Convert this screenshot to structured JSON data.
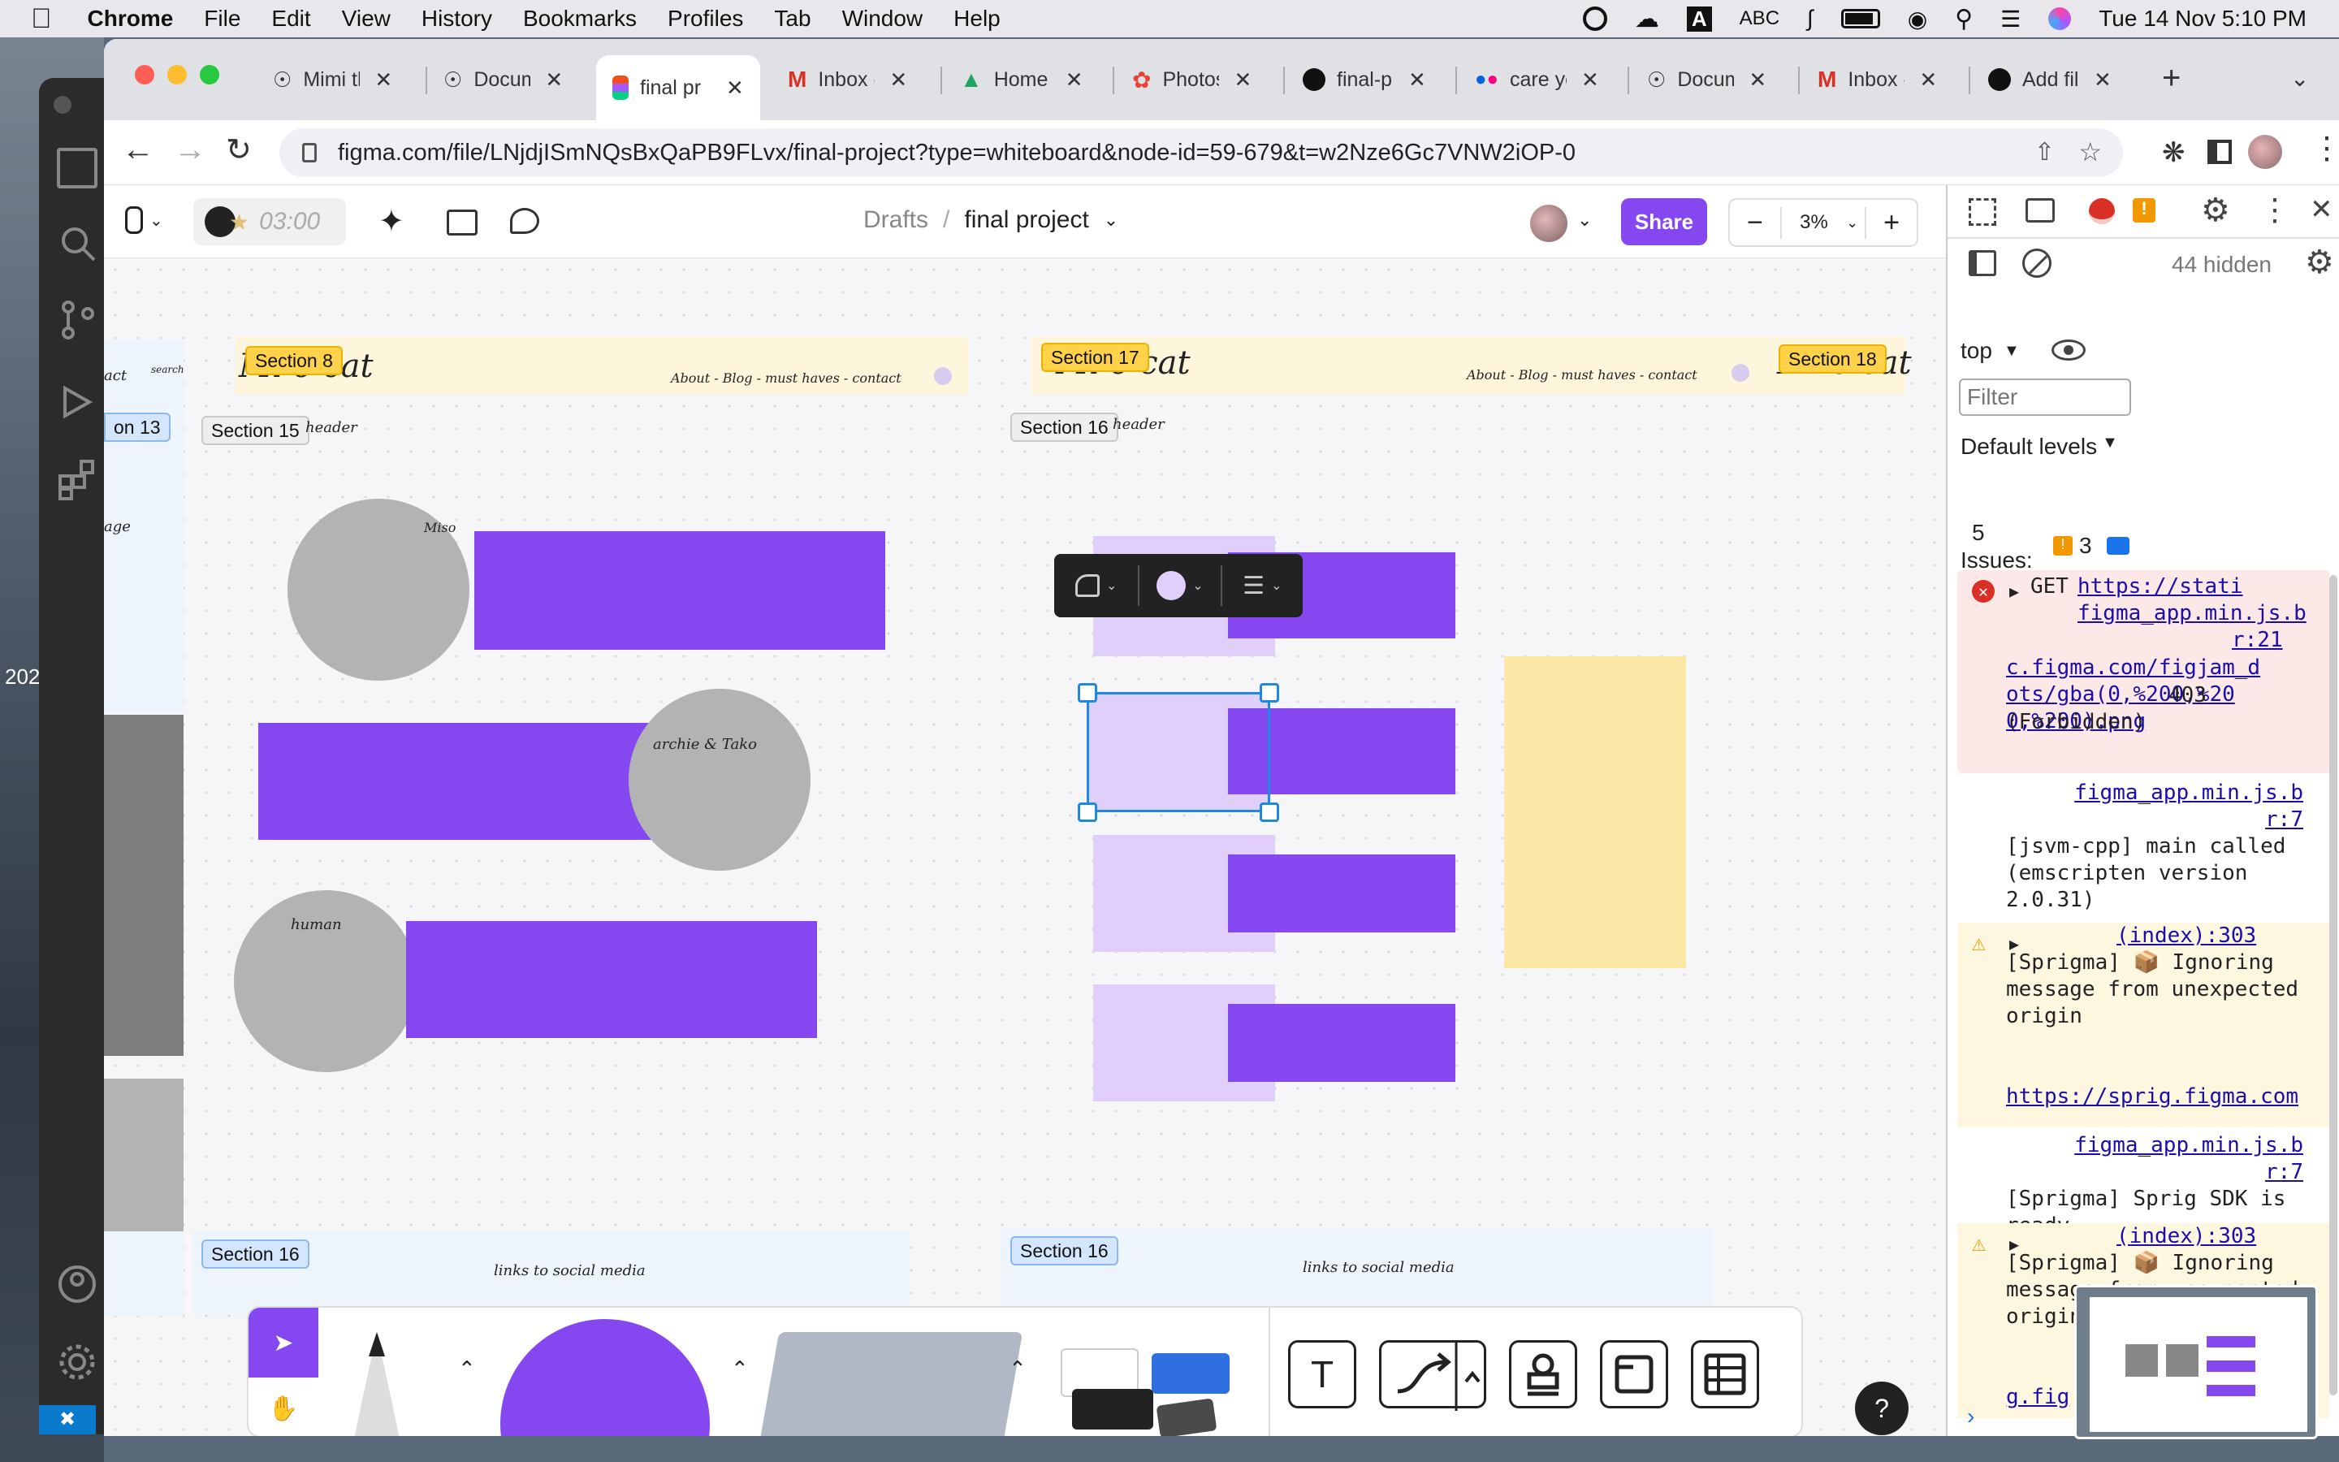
{
  "menubar": {
    "app": "Chrome",
    "items": [
      "File",
      "Edit",
      "View",
      "History",
      "Bookmarks",
      "Profiles",
      "Tab",
      "Window",
      "Help"
    ],
    "input_source": "ABC",
    "datetime": "Tue 14 Nov  5:10 PM"
  },
  "desktop": {
    "side_text": "202"
  },
  "tabs": [
    {
      "label": "Mimi th",
      "icon": "globe-icon"
    },
    {
      "label": "Docum",
      "icon": "globe-icon"
    },
    {
      "label": "final pr",
      "icon": "figma-icon",
      "active": true
    },
    {
      "label": "Inbox -",
      "icon": "gmail-icon"
    },
    {
      "label": "Home",
      "icon": "drive-icon"
    },
    {
      "label": "Photos",
      "icon": "photos-icon"
    },
    {
      "label": "final-p",
      "icon": "github-icon"
    },
    {
      "label": "care yo",
      "icon": "flickr-icon"
    },
    {
      "label": "Docum",
      "icon": "globe-icon"
    },
    {
      "label": "Inbox -",
      "icon": "gmail-icon"
    },
    {
      "label": "Add fil",
      "icon": "github-icon"
    }
  ],
  "address": {
    "url": "figma.com/file/LNjdjISmNQsBxQaPB9FLvx/final-project?type=whiteboard&node-id=59-679&t=w2Nze6Gc7VNW2iOP-0"
  },
  "figma": {
    "timer": "03:00",
    "breadcrumb_parent": "Drafts",
    "file_name": "final project",
    "share_label": "Share",
    "zoom": "3%",
    "sections": {
      "s8": "Section 8",
      "s13": "on 13",
      "s15": "Section 15",
      "s16a": "Section 16",
      "s17": "Section 17",
      "s18": "Section 18",
      "s16b": "Section 16",
      "s16c": "Section 16"
    },
    "canvas_text": {
      "logo1": "Mi o cat",
      "logo2": "Mi o cat",
      "logo3": "Mi o cat",
      "nav": "About - Blog - must haves - contact",
      "search": "search",
      "act": "act",
      "header": "header",
      "age": "age",
      "miso": "Miso",
      "archie": "archie & Tako",
      "human": "human",
      "links1": "links to social media",
      "links2": "links to social media"
    },
    "toolbar_extra": {
      "sticker": "Sticker"
    }
  },
  "devtools": {
    "hidden_count": "44 hidden",
    "context": "top",
    "filter_placeholder": "Filter",
    "levels": "Default levels",
    "issues_count": "5",
    "issues_label": "Issues:",
    "issues_warn": "3",
    "logs": [
      {
        "type": "error",
        "method": "GET",
        "url": "https://stati figma_app.min.js.b",
        "loc": "r:21",
        "detail_link": "c.figma.com/figjam_d ots/gba(0,%200,%20 0,%200).png",
        "detail_text": "403 (Forbidden)"
      },
      {
        "type": "info",
        "src": "figma_app.min.js.b r:7",
        "text": "[jsvm-cpp] main called (emscripten version 2.0.31)"
      },
      {
        "type": "warn",
        "src": "(index):303",
        "text": "[Sprigma] 📦 Ignoring message from unexpected origin",
        "link": "https://sprig.figma.com"
      },
      {
        "type": "info",
        "src": "figma_app.min.js.b r:7",
        "text": "[Sprigma] Sprig SDK is ready"
      },
      {
        "type": "warn",
        "src": "(index):303",
        "text": "[Sprigma] 📦 Ignoring message from unexpected origin",
        "link": "g.fig"
      }
    ]
  },
  "colors": {
    "accent": "#8547ef",
    "light_purple": "#e0cffb",
    "yellow_block": "#fbe8a6",
    "error_bg": "#fce8e6"
  }
}
